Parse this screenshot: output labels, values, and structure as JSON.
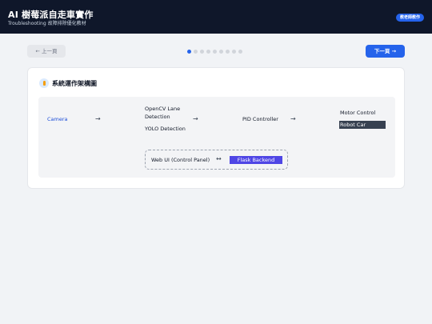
{
  "header": {
    "title": "AI 樹莓派自走車實作",
    "subtitle": "Troubleshooting 故障排除優化教材",
    "teacher_button": "教老師教作"
  },
  "nav": {
    "prev_label": "← 上一頁",
    "next_label": "下一頁 →",
    "dot_count": 9,
    "active_dot": 1
  },
  "section": {
    "icon": "lightbulb-icon",
    "title": "系統運作架構圖"
  },
  "diagram": {
    "camera": "Camera",
    "arrow_right": "→",
    "opencv_line1": "OpenCV Lane",
    "opencv_line2": "Detection",
    "yolo": "YOLO Detection",
    "pid": "PID Controller",
    "motor": "Motor Control",
    "robot": "Robot Car",
    "webui": "Web UI (Control Panel)",
    "arrow_both": "↔",
    "flask": "Flask Backend"
  },
  "colors": {
    "header_bg": "#0f172a",
    "accent": "#2563eb",
    "flask_bg": "#4f46e5",
    "robot_bg": "#374151"
  }
}
